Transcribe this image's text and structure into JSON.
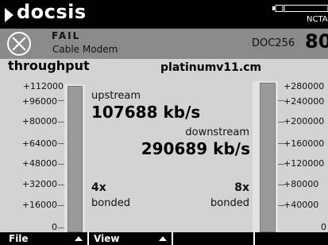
{
  "header": {
    "title": "docsis",
    "indicator": "NCTA"
  },
  "status": {
    "result": "FAIL",
    "device_type": "Cable Modem",
    "device_id": "DOC256",
    "big_value": "80"
  },
  "main": {
    "heading": "throughput",
    "server": "platinumv11.cm",
    "upstream": {
      "label": "upstream",
      "value": "107688 kb/s",
      "bonded_count": "4x",
      "bonded_label": "bonded",
      "level_fraction": 1.0
    },
    "downstream": {
      "label": "downstream",
      "value": "290689 kb/s",
      "bonded_count": "8x",
      "bonded_label": "bonded",
      "level_fraction": 1.0
    },
    "left_scale": [
      "+112000",
      "+96000",
      "+80000",
      "+64000",
      "+48000",
      "+32000",
      "+16000",
      "0"
    ],
    "right_scale": [
      "+280000",
      "+240000",
      "+200000",
      "+160000",
      "+120000",
      "+80000",
      "+40000",
      "0"
    ]
  },
  "menu": {
    "file": "File",
    "view": "View"
  },
  "colors": {
    "background": "#d3d3d3",
    "status_band": "#8a8a8a",
    "bar": "#9a9a9a"
  }
}
